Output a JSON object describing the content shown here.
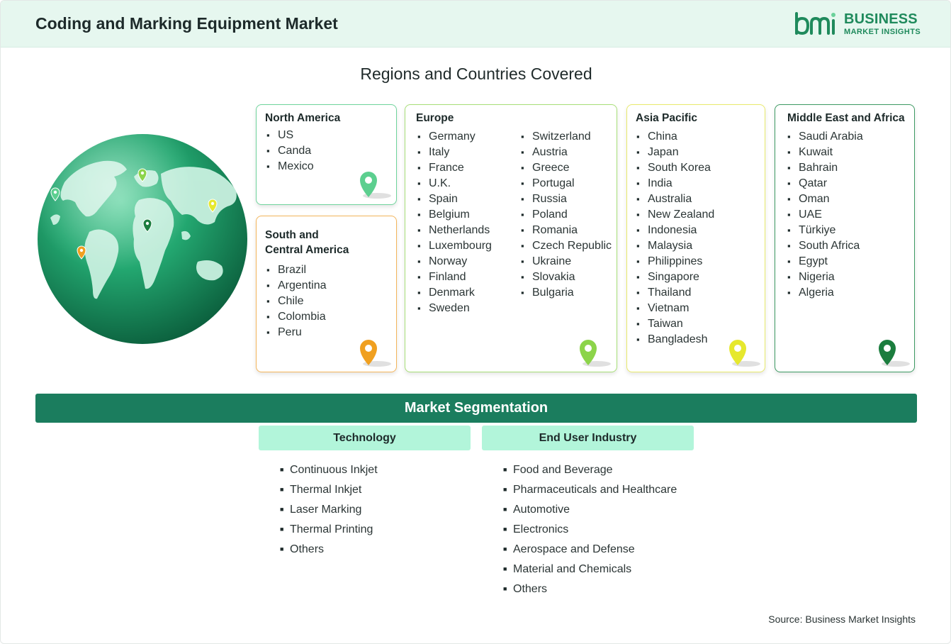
{
  "header": {
    "title": "Coding and Marking Equipment Market"
  },
  "logo": {
    "line1": "BUSINESS",
    "line2": "MARKET INSIGHTS"
  },
  "subtitle": "Regions and Countries Covered",
  "regions": {
    "north_america": {
      "title": "North America",
      "color": "#5ccf8f",
      "countries": [
        "US",
        "Canda",
        "Mexico"
      ]
    },
    "south_america": {
      "title_line1": "South and",
      "title_line2": "Central America",
      "color": "#f0a020",
      "countries": [
        "Brazil",
        "Argentina",
        "Chile",
        "Colombia",
        "Peru"
      ]
    },
    "europe": {
      "title": "Europe",
      "color": "#8cd44a",
      "col1": [
        "Germany",
        "Italy",
        "France",
        "U.K.",
        "Spain",
        "Belgium",
        "Netherlands",
        "Luxembourg",
        "Norway",
        "Finland",
        "Denmark",
        "Sweden"
      ],
      "col2": [
        "Switzerland",
        "Austria",
        "Greece",
        "Portugal",
        "Russia",
        "Poland",
        "Romania",
        "Czech Republic",
        "Ukraine",
        "Slovakia",
        "Bulgaria"
      ]
    },
    "asia_pacific": {
      "title": "Asia Pacific",
      "color": "#e6e82e",
      "countries": [
        "China",
        "Japan",
        "South Korea",
        "India",
        "Australia",
        "New Zealand",
        "Indonesia",
        "Malaysia",
        "Philippines",
        "Singapore",
        "Thailand",
        "Vietnam",
        "Taiwan",
        "Bangladesh"
      ]
    },
    "mea": {
      "title": "Middle East and Africa",
      "color": "#1b7d3e",
      "countries": [
        "Saudi Arabia",
        "Kuwait",
        "Bahrain",
        "Qatar",
        "Oman",
        "UAE",
        "Türkiye",
        "South Africa",
        "Egypt",
        "Nigeria",
        "Algeria"
      ]
    }
  },
  "segmentation": {
    "title": "Market Segmentation",
    "technology": {
      "title": "Technology",
      "items": [
        "Continuous Inkjet",
        "Thermal Inkjet",
        "Laser Marking",
        "Thermal Printing",
        "Others"
      ]
    },
    "end_user": {
      "title": "End User Industry",
      "items": [
        "Food and Beverage",
        "Pharmaceuticals and Healthcare",
        "Automotive",
        "Electronics",
        "Aerospace and Defense",
        "Material and Chemicals",
        "Others"
      ]
    }
  },
  "source": "Source: Business Market Insights",
  "icons": {
    "globe": "globe-icon",
    "pin": "map-pin-icon",
    "logo": "bmi-logo-icon"
  }
}
